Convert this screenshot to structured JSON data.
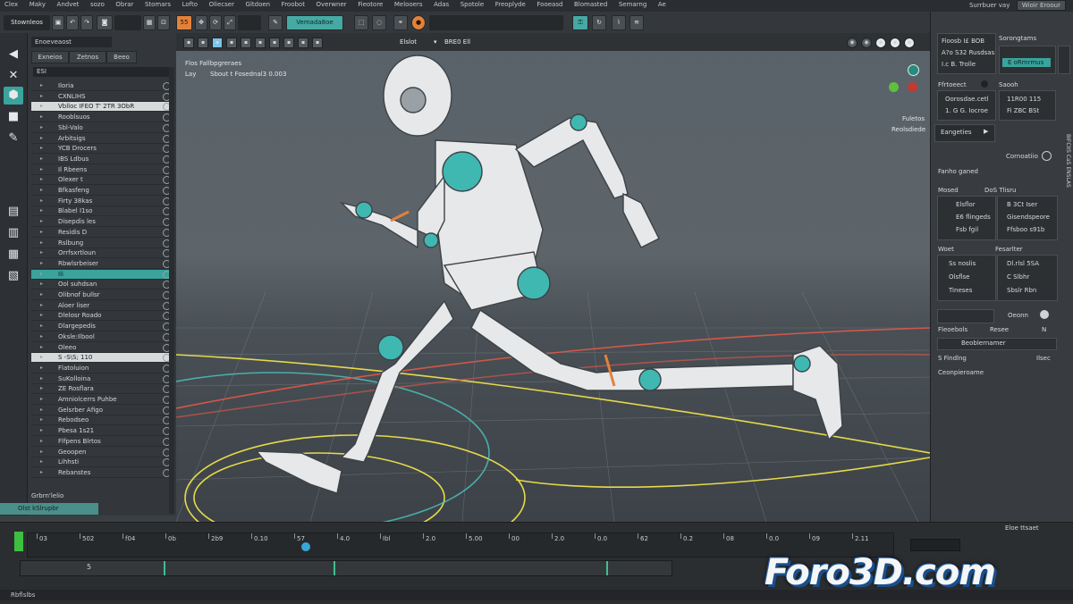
{
  "menu": [
    "Clex",
    "Maky",
    "Andvet",
    "sozo",
    "Obrar",
    "Stomars",
    "Lofto",
    "Oliecser",
    "Gltdoen",
    "Froobot",
    "Overwner",
    "Fieotore",
    "Melooers",
    "Adas",
    "Spotole",
    "Freoplyde",
    "Fooeasd",
    "Blomasted",
    "Semarng",
    "Ae"
  ],
  "menu_right": [
    "Surrbuer vay",
    "Wioir Eroour"
  ],
  "toolbar": {
    "preset_label": "Stownleos",
    "number_button": "55",
    "mode_label": "Vemada8oe"
  },
  "outliner": {
    "title": "Enoeveaost",
    "tabs": [
      "Exneios",
      "Zetnos",
      "Beeo"
    ],
    "search": "ESI",
    "rows": [
      {
        "label": "Iloria",
        "style": ""
      },
      {
        "label": "CXNLIHS",
        "style": ""
      },
      {
        "label": "Vblloc IFEO T' 2TR 3ObR",
        "style": "sel"
      },
      {
        "label": "Rooblsuos",
        "style": ""
      },
      {
        "label": "Sbl-Valo",
        "style": ""
      },
      {
        "label": "Arbitsigs",
        "style": ""
      },
      {
        "label": "YCB Drocers",
        "style": ""
      },
      {
        "label": "IBS Ldbus",
        "style": ""
      },
      {
        "label": "Il Rbeens",
        "style": ""
      },
      {
        "label": "Olexer t",
        "style": ""
      },
      {
        "label": "Bfkasfeng",
        "style": ""
      },
      {
        "label": "Firty 38kas",
        "style": ""
      },
      {
        "label": "Blabel I1so",
        "style": ""
      },
      {
        "label": "Disepdis les",
        "style": ""
      },
      {
        "label": "Residis D",
        "style": ""
      },
      {
        "label": "Rslbung",
        "style": ""
      },
      {
        "label": "Orrfsxrtloun",
        "style": ""
      },
      {
        "label": "Rbwlsrbeiser",
        "style": ""
      },
      {
        "label": "Ili",
        "style": "hl"
      },
      {
        "label": "Ool suhdsan",
        "style": ""
      },
      {
        "label": "Olibnof bullsr",
        "style": ""
      },
      {
        "label": "Aloer liser",
        "style": ""
      },
      {
        "label": "Dlelosr Roado",
        "style": ""
      },
      {
        "label": "Dlargepedis",
        "style": ""
      },
      {
        "label": "Oksle:Ilbool",
        "style": ""
      },
      {
        "label": "Oleeo",
        "style": ""
      },
      {
        "label": "S -S\\S; 110",
        "style": "sel"
      },
      {
        "label": "Flatoluion",
        "style": ""
      },
      {
        "label": "SuKolloina",
        "style": ""
      },
      {
        "label": "ZE Rosflara",
        "style": ""
      },
      {
        "label": "Amniolcerrs Puhbe",
        "style": ""
      },
      {
        "label": "Gelsrber Afigo",
        "style": ""
      },
      {
        "label": "Rebodseo",
        "style": ""
      },
      {
        "label": "Pbesa 1s21",
        "style": ""
      },
      {
        "label": "Flfpens Blrtos",
        "style": ""
      },
      {
        "label": "Geoopen",
        "style": ""
      },
      {
        "label": "Lihhsti",
        "style": ""
      },
      {
        "label": "Rebanstes",
        "style": ""
      }
    ],
    "footer_label": "Grbrn'lelio",
    "footer_btn": "Olst kSlrupbr"
  },
  "viewport": {
    "header_label": "Elslot",
    "header_value": "BRE0 Ell",
    "overlay_line1": "Flos  Fallbpgreraes",
    "overlay_line2_a": "Lay",
    "overlay_line2_b": "Sbout t Fosednal3 0.003",
    "right_labels": [
      "Fuletos",
      "Reolsdiede"
    ]
  },
  "right_panel": {
    "box1": {
      "left_lines": [
        "Fioosb I£ BOB",
        "A?o S32 Rusdsas",
        "I.c B. Trolle"
      ],
      "right_header": "Sorongtams",
      "teal": "E oRmrmus"
    },
    "box2": {
      "left_header": "Ffrtoeect",
      "left_lines": [
        "Oorosdae.cetl",
        "1. G G. Iocroe"
      ],
      "right_header": "Saooh",
      "right_lines": [
        "11R00 115",
        "Fi ZBC BSt"
      ]
    },
    "engine_label": "Eangeties",
    "combo_label": "Cornoatiio",
    "section1": "Fanho ganed",
    "section2_left": "Mosed",
    "section2_right": "DoS Tlisru",
    "box3_left": [
      "Elsflor",
      "E6 flingeds",
      "Fsb fgil"
    ],
    "box3_right": [
      "B 3Ct Iser",
      "Gisendspeore",
      "Ffsboo s91b"
    ],
    "section3_left": "Woet",
    "section3_right": "Fesarlter",
    "box4_left": [
      "Ss noslis",
      "Olsflse",
      "Tineses"
    ],
    "box4_right": [
      "Dl.rlsl 5SA",
      "C Slbhr",
      "Sbslr Rbn"
    ],
    "combo2": "Oeonn",
    "row1_left": "Fleoebols",
    "row1_mid": "Resee",
    "row1_right": "N",
    "row2": "Beoblernamer",
    "row3_left": "S Findlng",
    "row3_right": "Ilsec",
    "row4": "Ceonpieroame",
    "vertical": "BIFCIIS CaS ENSLAS"
  },
  "timeline": {
    "tick_labels": [
      "03",
      "502",
      "f04",
      "0b",
      "2b9",
      "0.10",
      "57",
      "4.0",
      "Ibl",
      "2.0",
      "5.00",
      "00",
      "2.0",
      "0.0",
      "62",
      "0.2",
      "08",
      "0.0",
      "09",
      "2.11"
    ],
    "current_frame": "57",
    "track_label": "5",
    "footer": "Rbflslbs",
    "right_label": "Eloe ttsaet",
    "watermark": "Foro3D.com"
  }
}
